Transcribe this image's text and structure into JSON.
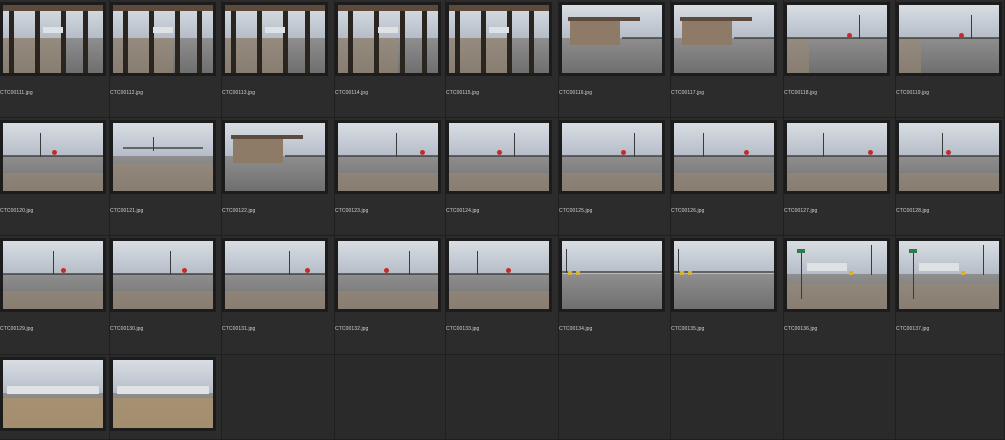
{
  "browser": {
    "thumbnails": [
      {
        "filename": "CTC00111.jpg",
        "scene": "porch"
      },
      {
        "filename": "CTC00112.jpg",
        "scene": "porch"
      },
      {
        "filename": "CTC00113.jpg",
        "scene": "porch"
      },
      {
        "filename": "CTC00114.jpg",
        "scene": "porch"
      },
      {
        "filename": "CTC00115.jpg",
        "scene": "porch"
      },
      {
        "filename": "CTC00116.jpg",
        "scene": "building"
      },
      {
        "filename": "CTC00117.jpg",
        "scene": "building"
      },
      {
        "filename": "CTC00118.jpg",
        "scene": "road-pole"
      },
      {
        "filename": "CTC00119.jpg",
        "scene": "road-pole"
      },
      {
        "filename": "CTC00120.jpg",
        "scene": "road-sign"
      },
      {
        "filename": "CTC00121.jpg",
        "scene": "dirt-fence"
      },
      {
        "filename": "CTC00122.jpg",
        "scene": "building"
      },
      {
        "filename": "CTC00123.jpg",
        "scene": "road-sign"
      },
      {
        "filename": "CTC00124.jpg",
        "scene": "road-sign"
      },
      {
        "filename": "CTC00125.jpg",
        "scene": "road-sign"
      },
      {
        "filename": "CTC00126.jpg",
        "scene": "road-sign"
      },
      {
        "filename": "CTC00127.jpg",
        "scene": "road-sign"
      },
      {
        "filename": "CTC00128.jpg",
        "scene": "road-sign"
      },
      {
        "filename": "CTC00129.jpg",
        "scene": "road-sign"
      },
      {
        "filename": "CTC00130.jpg",
        "scene": "road-sign"
      },
      {
        "filename": "CTC00131.jpg",
        "scene": "road-sign"
      },
      {
        "filename": "CTC00132.jpg",
        "scene": "road-sign"
      },
      {
        "filename": "CTC00133.jpg",
        "scene": "road-sign"
      },
      {
        "filename": "CTC00134.jpg",
        "scene": "road-yellow"
      },
      {
        "filename": "CTC00135.jpg",
        "scene": "road-yellow"
      },
      {
        "filename": "CTC00136.jpg",
        "scene": "street-sign"
      },
      {
        "filename": "CTC00137.jpg",
        "scene": "street-sign"
      },
      {
        "filename": "",
        "scene": "warehouse"
      },
      {
        "filename": "",
        "scene": "warehouse"
      }
    ],
    "empty_cells": 7
  }
}
